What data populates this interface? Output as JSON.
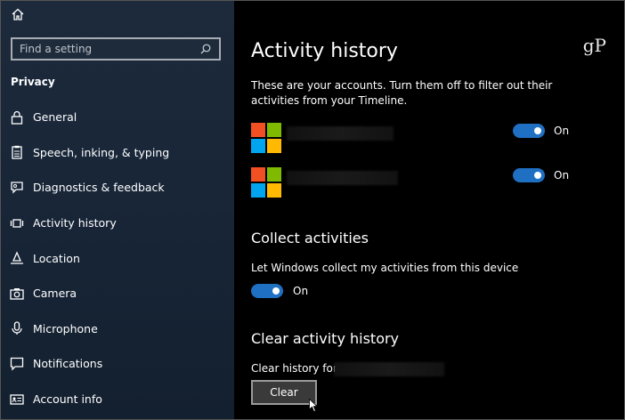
{
  "sidebar": {
    "search": {
      "placeholder": "Find a setting"
    },
    "section_label": "Privacy",
    "items": [
      {
        "label": "General",
        "icon": "lock-icon"
      },
      {
        "label": "Speech, inking, & typing",
        "icon": "clipboard-icon"
      },
      {
        "label": "Diagnostics & feedback",
        "icon": "feedback-icon"
      },
      {
        "label": "Activity history",
        "icon": "activity-icon"
      },
      {
        "label": "Location",
        "icon": "location-icon"
      },
      {
        "label": "Camera",
        "icon": "camera-icon"
      },
      {
        "label": "Microphone",
        "icon": "microphone-icon"
      },
      {
        "label": "Notifications",
        "icon": "notifications-icon"
      },
      {
        "label": "Account info",
        "icon": "account-info-icon"
      }
    ]
  },
  "main": {
    "title": "Activity history",
    "watermark": "gP",
    "description": "These are your accounts. Turn them off to filter out their activities from your Timeline.",
    "accounts": [
      {
        "toggle_state": "On"
      },
      {
        "toggle_state": "On"
      }
    ],
    "collect": {
      "heading": "Collect activities",
      "text": "Let Windows collect my activities from this device",
      "toggle_state": "On"
    },
    "clear": {
      "heading": "Clear activity history",
      "text": "Clear history for",
      "button_label": "Clear"
    }
  },
  "colors": {
    "sidebar_bg": "#182638",
    "toggle_on": "#1f6fc2",
    "ms_red": "#f25022",
    "ms_green": "#7fba00",
    "ms_blue": "#00a4ef",
    "ms_yellow": "#ffb900"
  }
}
